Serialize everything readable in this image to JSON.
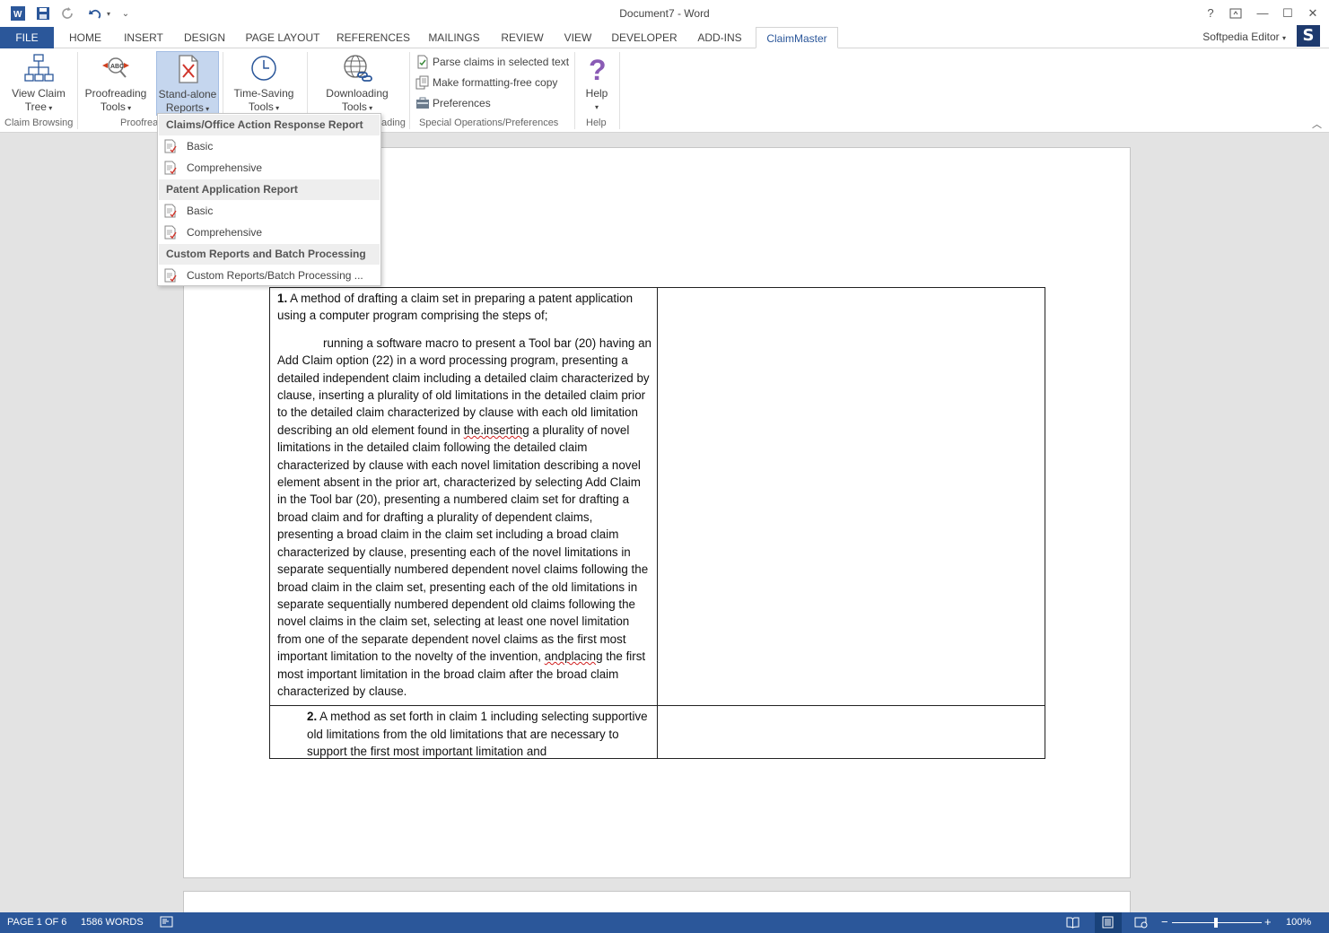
{
  "window": {
    "title": "Document7 - Word",
    "user": "Softpedia Editor",
    "help_glyph": "?",
    "minimize_glyph": "—",
    "maximize_glyph": "☐",
    "close_glyph": "✕",
    "restore_glyph": "❐"
  },
  "tabs": {
    "file": "FILE",
    "home": "HOME",
    "insert": "INSERT",
    "design": "DESIGN",
    "page_layout": "PAGE LAYOUT",
    "references": "REFERENCES",
    "mailings": "MAILINGS",
    "review": "REVIEW",
    "view": "VIEW",
    "developer": "DEVELOPER",
    "add_ins": "ADD-INS",
    "claimmaster": "ClaimMaster"
  },
  "ribbon": {
    "view_claim_tree": [
      "View Claim",
      "Tree"
    ],
    "proofreading": [
      "Proofreading",
      "Tools"
    ],
    "standalone": [
      "Stand-alone",
      "Reports"
    ],
    "time_saving": [
      "Time-Saving",
      "Tools"
    ],
    "downloading": [
      "Downloading",
      "Tools"
    ],
    "help": "Help",
    "parse_claims": "Parse claims in selected text",
    "formatting_free": "Make formatting-free copy",
    "preferences": "Preferences",
    "groups": {
      "claim_browsing": "Claim Browsing",
      "proofreading": "Proofrea",
      "downloading": "ading",
      "special_ops": "Special Operations/Preferences",
      "help": "Help"
    }
  },
  "dropdown": {
    "section1": "Claims/Office Action Response Report",
    "s1_basic": "Basic",
    "s1_comprehensive": "Comprehensive",
    "section2": "Patent Application Report",
    "s2_basic": "Basic",
    "s2_comprehensive": "Comprehensive",
    "section3": "Custom Reports and Batch Processing",
    "s3_custom": "Custom Reports/Batch Processing ..."
  },
  "document": {
    "claim1_number": "1.",
    "claim1_intro": " A method of drafting a claim set in preparing a patent application using a computer program comprising the steps of;",
    "claim1_body_a": "running a software macro to present a Tool bar (20) having an Add Claim option (22) in a word processing program, presenting a detailed independent claim including a detailed claim characterized by clause, inserting a plurality of old limitations in the detailed claim prior to the detailed claim characterized by clause with each old limitation describing an old element found in ",
    "claim1_spell1": "the.inserting",
    "claim1_body_b": " a plurality of novel limitations in the detailed claim following the detailed claim characterized by clause with each novel limitation describing a novel element absent in the prior art, characterized by selecting Add Claim in the Tool bar (20), presenting a numbered claim set for drafting a broad claim and for drafting a plurality of dependent claims, presenting a broad claim in the claim set including a broad claim characterized by clause, presenting each of the novel limitations in separate sequentially numbered dependent novel claims following the broad claim in the claim set, presenting each of the old limitations in separate sequentially numbered dependent old claims following the novel claims in the claim set, selecting at least one novel limitation from one of the separate dependent novel claims as the first most important limitation to the novelty of the invention, ",
    "claim1_spell2": "andplacing",
    "claim1_body_c": " the first most important limitation in the broad claim after the broad claim characterized by clause.",
    "claim2_number": "2.",
    "claim2_text": " A method as set forth in claim 1 including selecting supportive old limitations from the old limitations that are necessary to support the first most important limitation and"
  },
  "statusbar": {
    "page": "PAGE 1 OF 6",
    "words": "1586 WORDS",
    "zoom": "100%",
    "minus": "−",
    "plus": "+"
  },
  "colors": {
    "accent": "#2b579a",
    "menu_highlight": "#c5d6ee"
  }
}
